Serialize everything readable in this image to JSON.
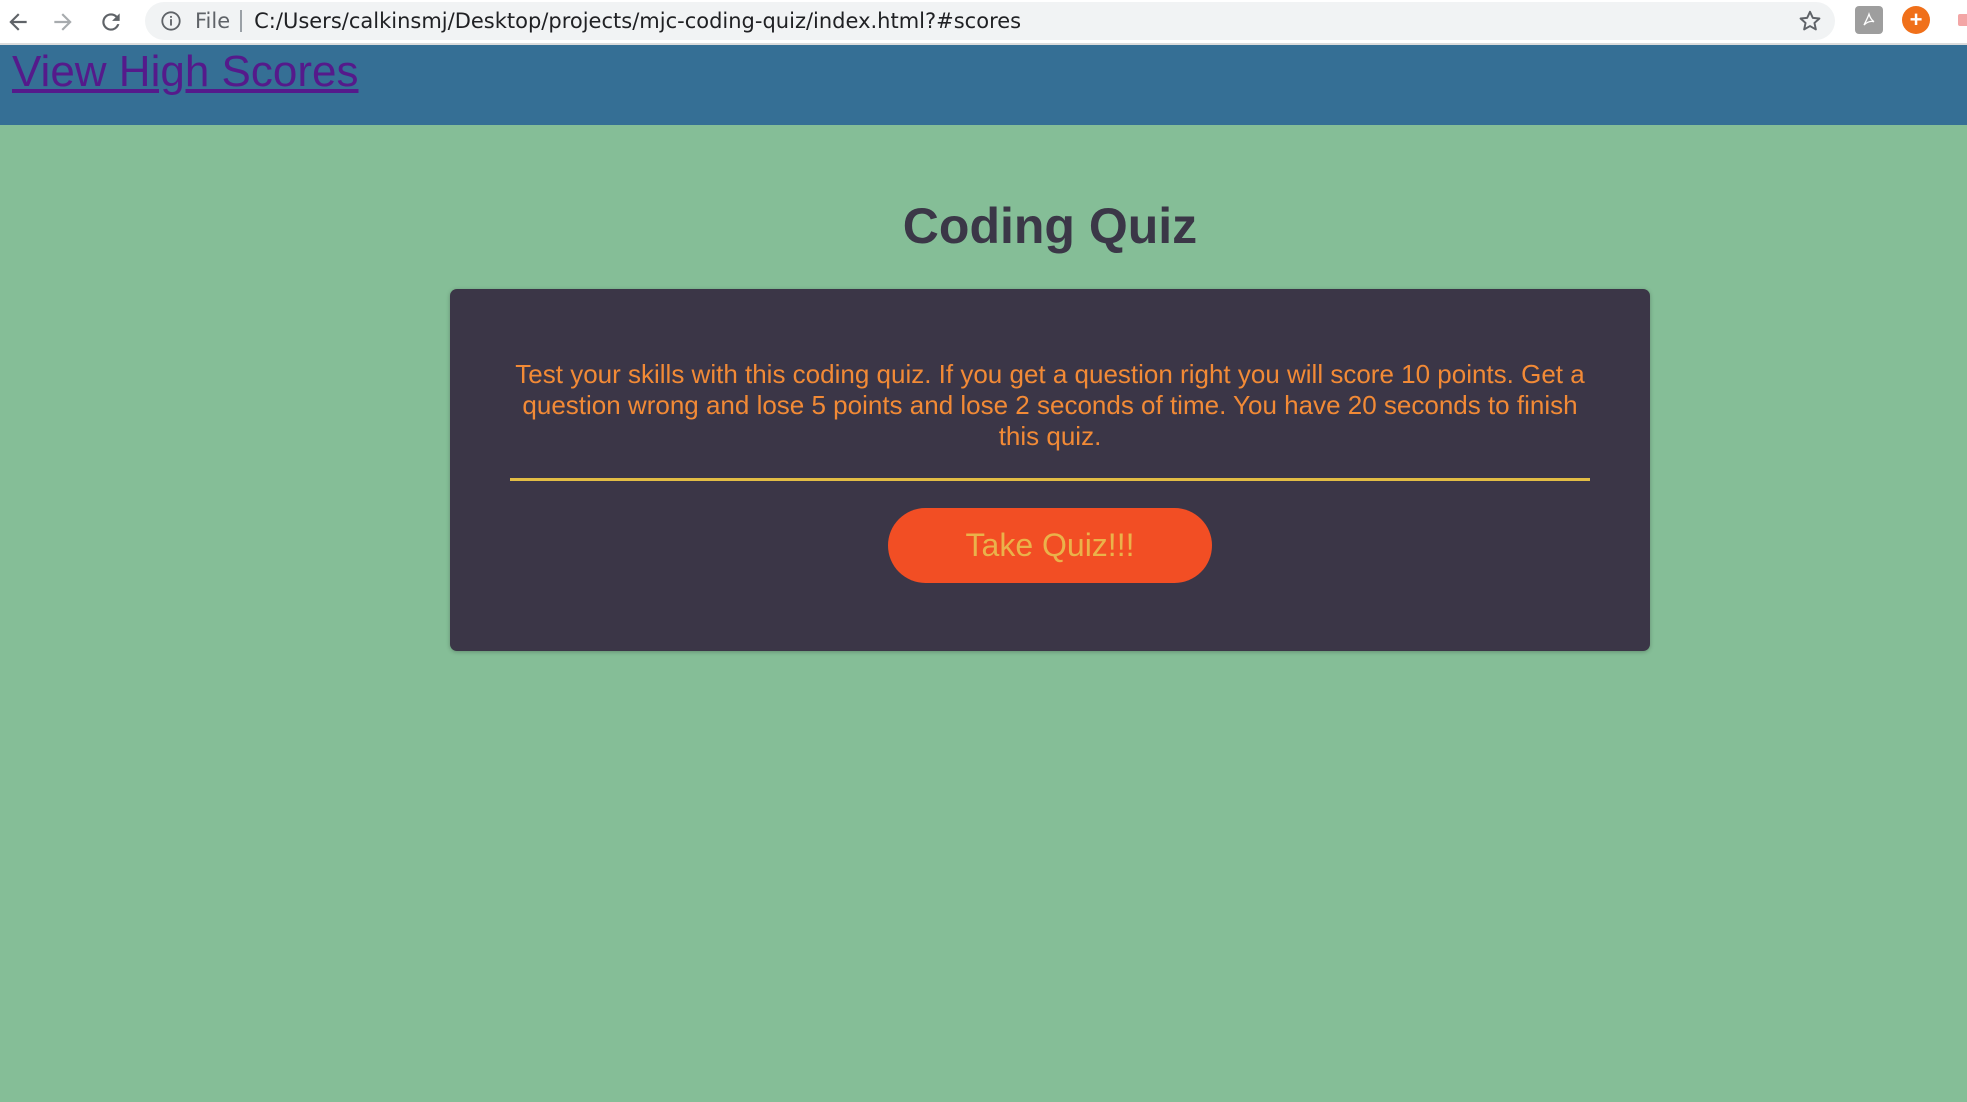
{
  "browser": {
    "scheme_label": "File",
    "url": "C:/Users/calkinsmj/Desktop/projects/mjc-coding-quiz/index.html?#scores",
    "icons": [
      "back-arrow-icon",
      "forward-arrow-icon",
      "reload-icon",
      "info-icon",
      "star-icon",
      "pdf-extension-icon",
      "plus-extension-icon"
    ]
  },
  "header": {
    "high_scores_link": "View High Scores"
  },
  "main": {
    "title": "Coding Quiz",
    "intro_text": "Test your skills with this coding quiz. If you get a question right you will score 10 points. Get a question wrong and lose 5 points and lose 2 seconds of time. You have 20 seconds to finish this quiz.",
    "take_quiz_label": "Take Quiz!!!"
  },
  "colors": {
    "page_background": "#85be97",
    "header_background": "#356f95",
    "card_background": "#3b3647",
    "text_orange": "#f28a36",
    "divider_gold": "#e2bd45",
    "button_background": "#f24e24",
    "button_text": "#eab24a",
    "link_visited": "#551a8b"
  }
}
